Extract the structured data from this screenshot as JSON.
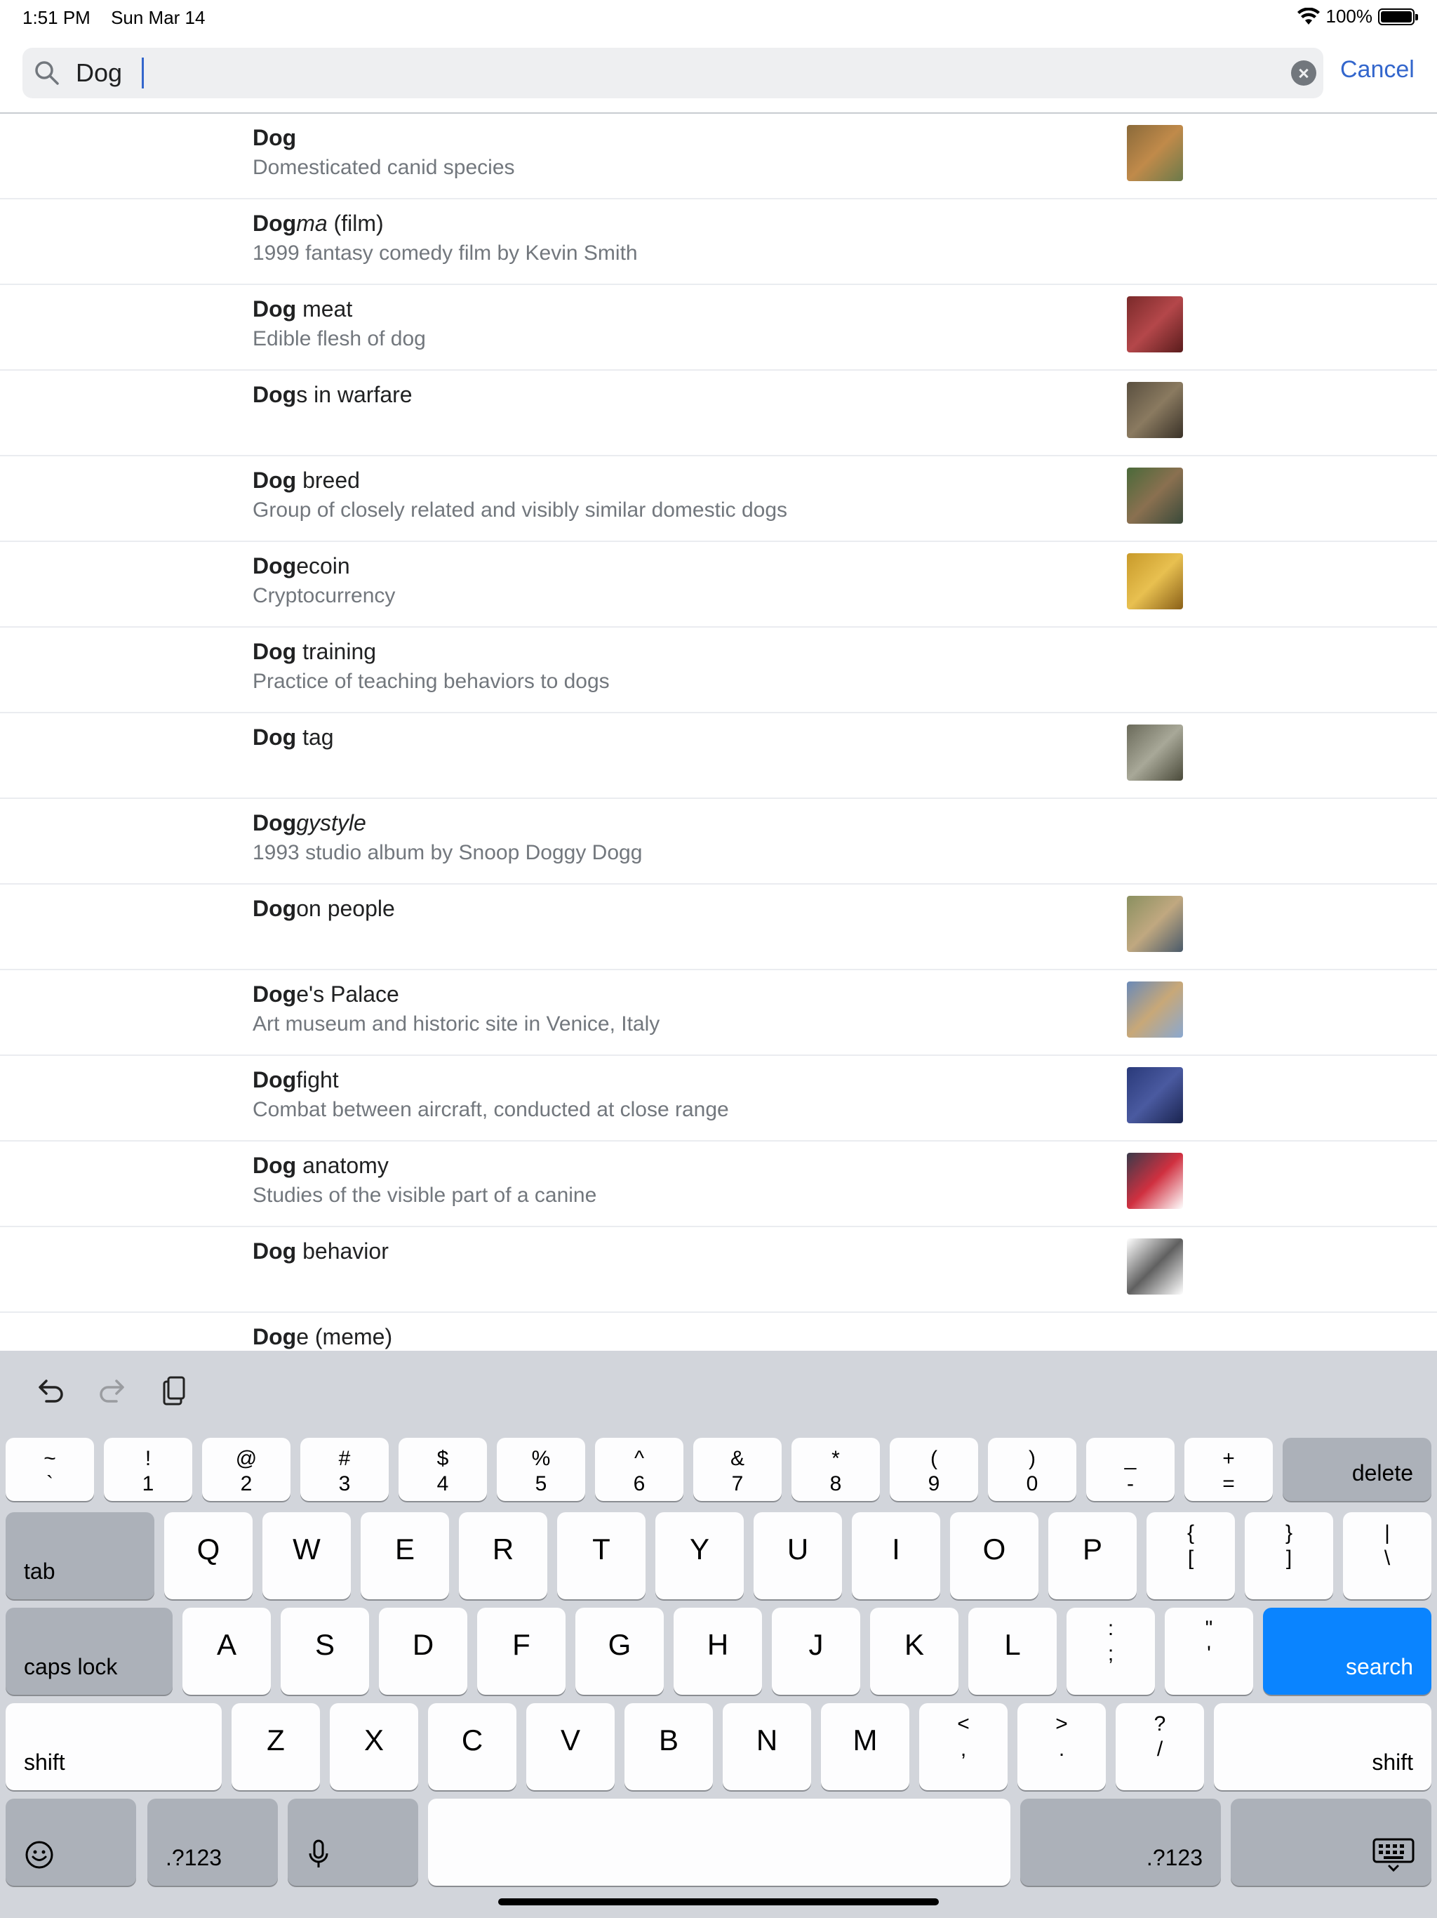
{
  "status": {
    "time": "1:51 PM",
    "date": "Sun Mar 14",
    "battery": "100%"
  },
  "search": {
    "query": "Dog",
    "cancel": "Cancel"
  },
  "results": [
    {
      "bold": "Dog",
      "rest": "",
      "desc": "Domesticated canid species",
      "thumb": "dog-collage",
      "colors": [
        "#8a6a3a",
        "#c08a4a",
        "#6b7a4a"
      ]
    },
    {
      "bold": "Dog",
      "rest": "ma",
      "rest_suffix": " (film)",
      "italic": true,
      "desc": "1999 fantasy comedy film by Kevin Smith",
      "thumb": ""
    },
    {
      "bold": "Dog",
      "rest": " meat",
      "desc": "Edible flesh of dog",
      "thumb": "meat",
      "colors": [
        "#7a2a2a",
        "#b4474a",
        "#5a1c1c"
      ]
    },
    {
      "bold": "Dog",
      "rest": "s in warfare",
      "desc": "",
      "thumb": "military-dog",
      "colors": [
        "#5a5040",
        "#8a7a60",
        "#3a3228"
      ]
    },
    {
      "bold": "Dog",
      "rest": " breed",
      "desc": "Group of closely related and visibly similar domestic dogs",
      "thumb": "breeds",
      "colors": [
        "#4a6a3a",
        "#8a7050",
        "#3a4a3a"
      ]
    },
    {
      "bold": "Dog",
      "rest": "ecoin",
      "desc": "Cryptocurrency",
      "thumb": "coin",
      "colors": [
        "#c89a2a",
        "#e8c050",
        "#8a6018"
      ]
    },
    {
      "bold": "Dog",
      "rest": " training",
      "desc": "Practice of teaching behaviors to dogs",
      "thumb": ""
    },
    {
      "bold": "Dog",
      "rest": " tag",
      "desc": "",
      "thumb": "tag",
      "colors": [
        "#6a6a5a",
        "#a8a898",
        "#4a4a3a"
      ]
    },
    {
      "bold": "Dog",
      "rest": "gystyle",
      "italic": true,
      "desc": "1993 studio album by Snoop Doggy Dogg",
      "thumb": ""
    },
    {
      "bold": "Dog",
      "rest": "on people",
      "desc": "",
      "thumb": "dogon",
      "colors": [
        "#8a9060",
        "#c0a880",
        "#4a5a6a"
      ]
    },
    {
      "bold": "Dog",
      "rest": "e's Palace",
      "desc": "Art museum and historic site in Venice, Italy",
      "thumb": "palace",
      "colors": [
        "#6a8ab8",
        "#c8a878",
        "#8aa8d0"
      ]
    },
    {
      "bold": "Dog",
      "rest": "fight",
      "desc": "Combat between aircraft, conducted at close range",
      "thumb": "aircraft",
      "colors": [
        "#2a3a7a",
        "#4a5aa0",
        "#1a2450"
      ]
    },
    {
      "bold": "Dog",
      "rest": " anatomy",
      "desc": "Studies of the visible part of a canine",
      "thumb": "anatomy",
      "colors": [
        "#3a3a4a",
        "#d03040",
        "#ffffff"
      ]
    },
    {
      "bold": "Dog",
      "rest": " behavior",
      "desc": "",
      "thumb": "sketch",
      "colors": [
        "#ffffff",
        "#606060",
        "#ffffff"
      ]
    },
    {
      "bold": "Dog",
      "rest": "e (meme)",
      "desc": "",
      "thumb": ""
    }
  ],
  "keyboard": {
    "row1": [
      [
        "~",
        "`"
      ],
      [
        "!",
        "1"
      ],
      [
        "@",
        "2"
      ],
      [
        "#",
        "3"
      ],
      [
        "$",
        "4"
      ],
      [
        "%",
        "5"
      ],
      [
        "^",
        "6"
      ],
      [
        "&",
        "7"
      ],
      [
        "*",
        "8"
      ],
      [
        "(",
        "9"
      ],
      [
        ")",
        "0"
      ],
      [
        "_",
        "-"
      ],
      [
        "+",
        "="
      ]
    ],
    "delete": "delete",
    "tab": "tab",
    "row2": [
      "Q",
      "W",
      "E",
      "R",
      "T",
      "Y",
      "U",
      "I",
      "O",
      "P"
    ],
    "row2_sym": [
      [
        "{",
        "["
      ],
      [
        "}",
        "]"
      ],
      [
        "|",
        "\\"
      ]
    ],
    "caps": "caps lock",
    "row3": [
      "A",
      "S",
      "D",
      "F",
      "G",
      "H",
      "J",
      "K",
      "L"
    ],
    "row3_sym": [
      [
        ":",
        ";"
      ],
      [
        "\"",
        "'"
      ]
    ],
    "search": "search",
    "shift": "shift",
    "row4": [
      "Z",
      "X",
      "C",
      "V",
      "B",
      "N",
      "M"
    ],
    "row4_sym": [
      [
        "<",
        ","
      ],
      [
        ">",
        "."
      ],
      [
        "?",
        "/"
      ]
    ],
    "num": ".?123"
  }
}
